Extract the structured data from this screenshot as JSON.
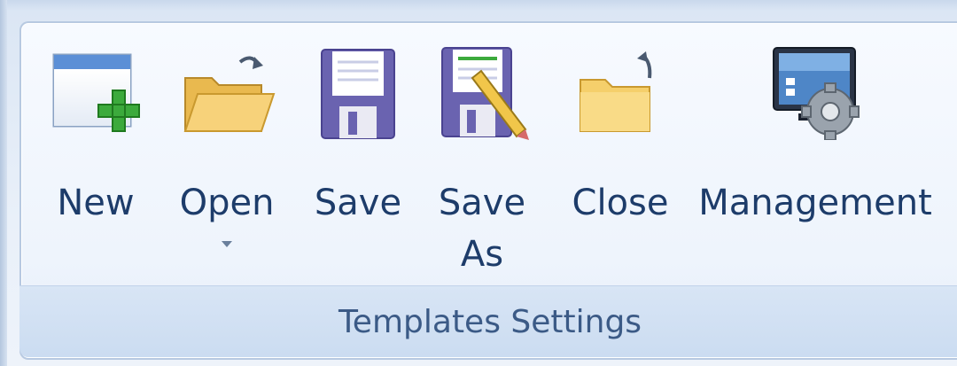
{
  "ribbon": {
    "group_title": "Templates Settings",
    "buttons": [
      {
        "label": "New",
        "icon": "new-document-icon"
      },
      {
        "label": "Open",
        "icon": "open-folder-icon",
        "has_dropdown": true
      },
      {
        "label": "Save",
        "icon": "floppy-disk-icon"
      },
      {
        "label_line1": "Save",
        "label_line2": "As",
        "icon": "save-as-icon"
      },
      {
        "label": "Close",
        "icon": "close-folder-icon"
      },
      {
        "label": "Management",
        "icon": "management-icon"
      }
    ]
  },
  "colors": {
    "label": "#1d3c6a",
    "group_title": "#3b5a86",
    "accent_green": "#3caa3c",
    "floppy_purple": "#6a63b0",
    "folder_yellow": "#f4cf6b"
  }
}
